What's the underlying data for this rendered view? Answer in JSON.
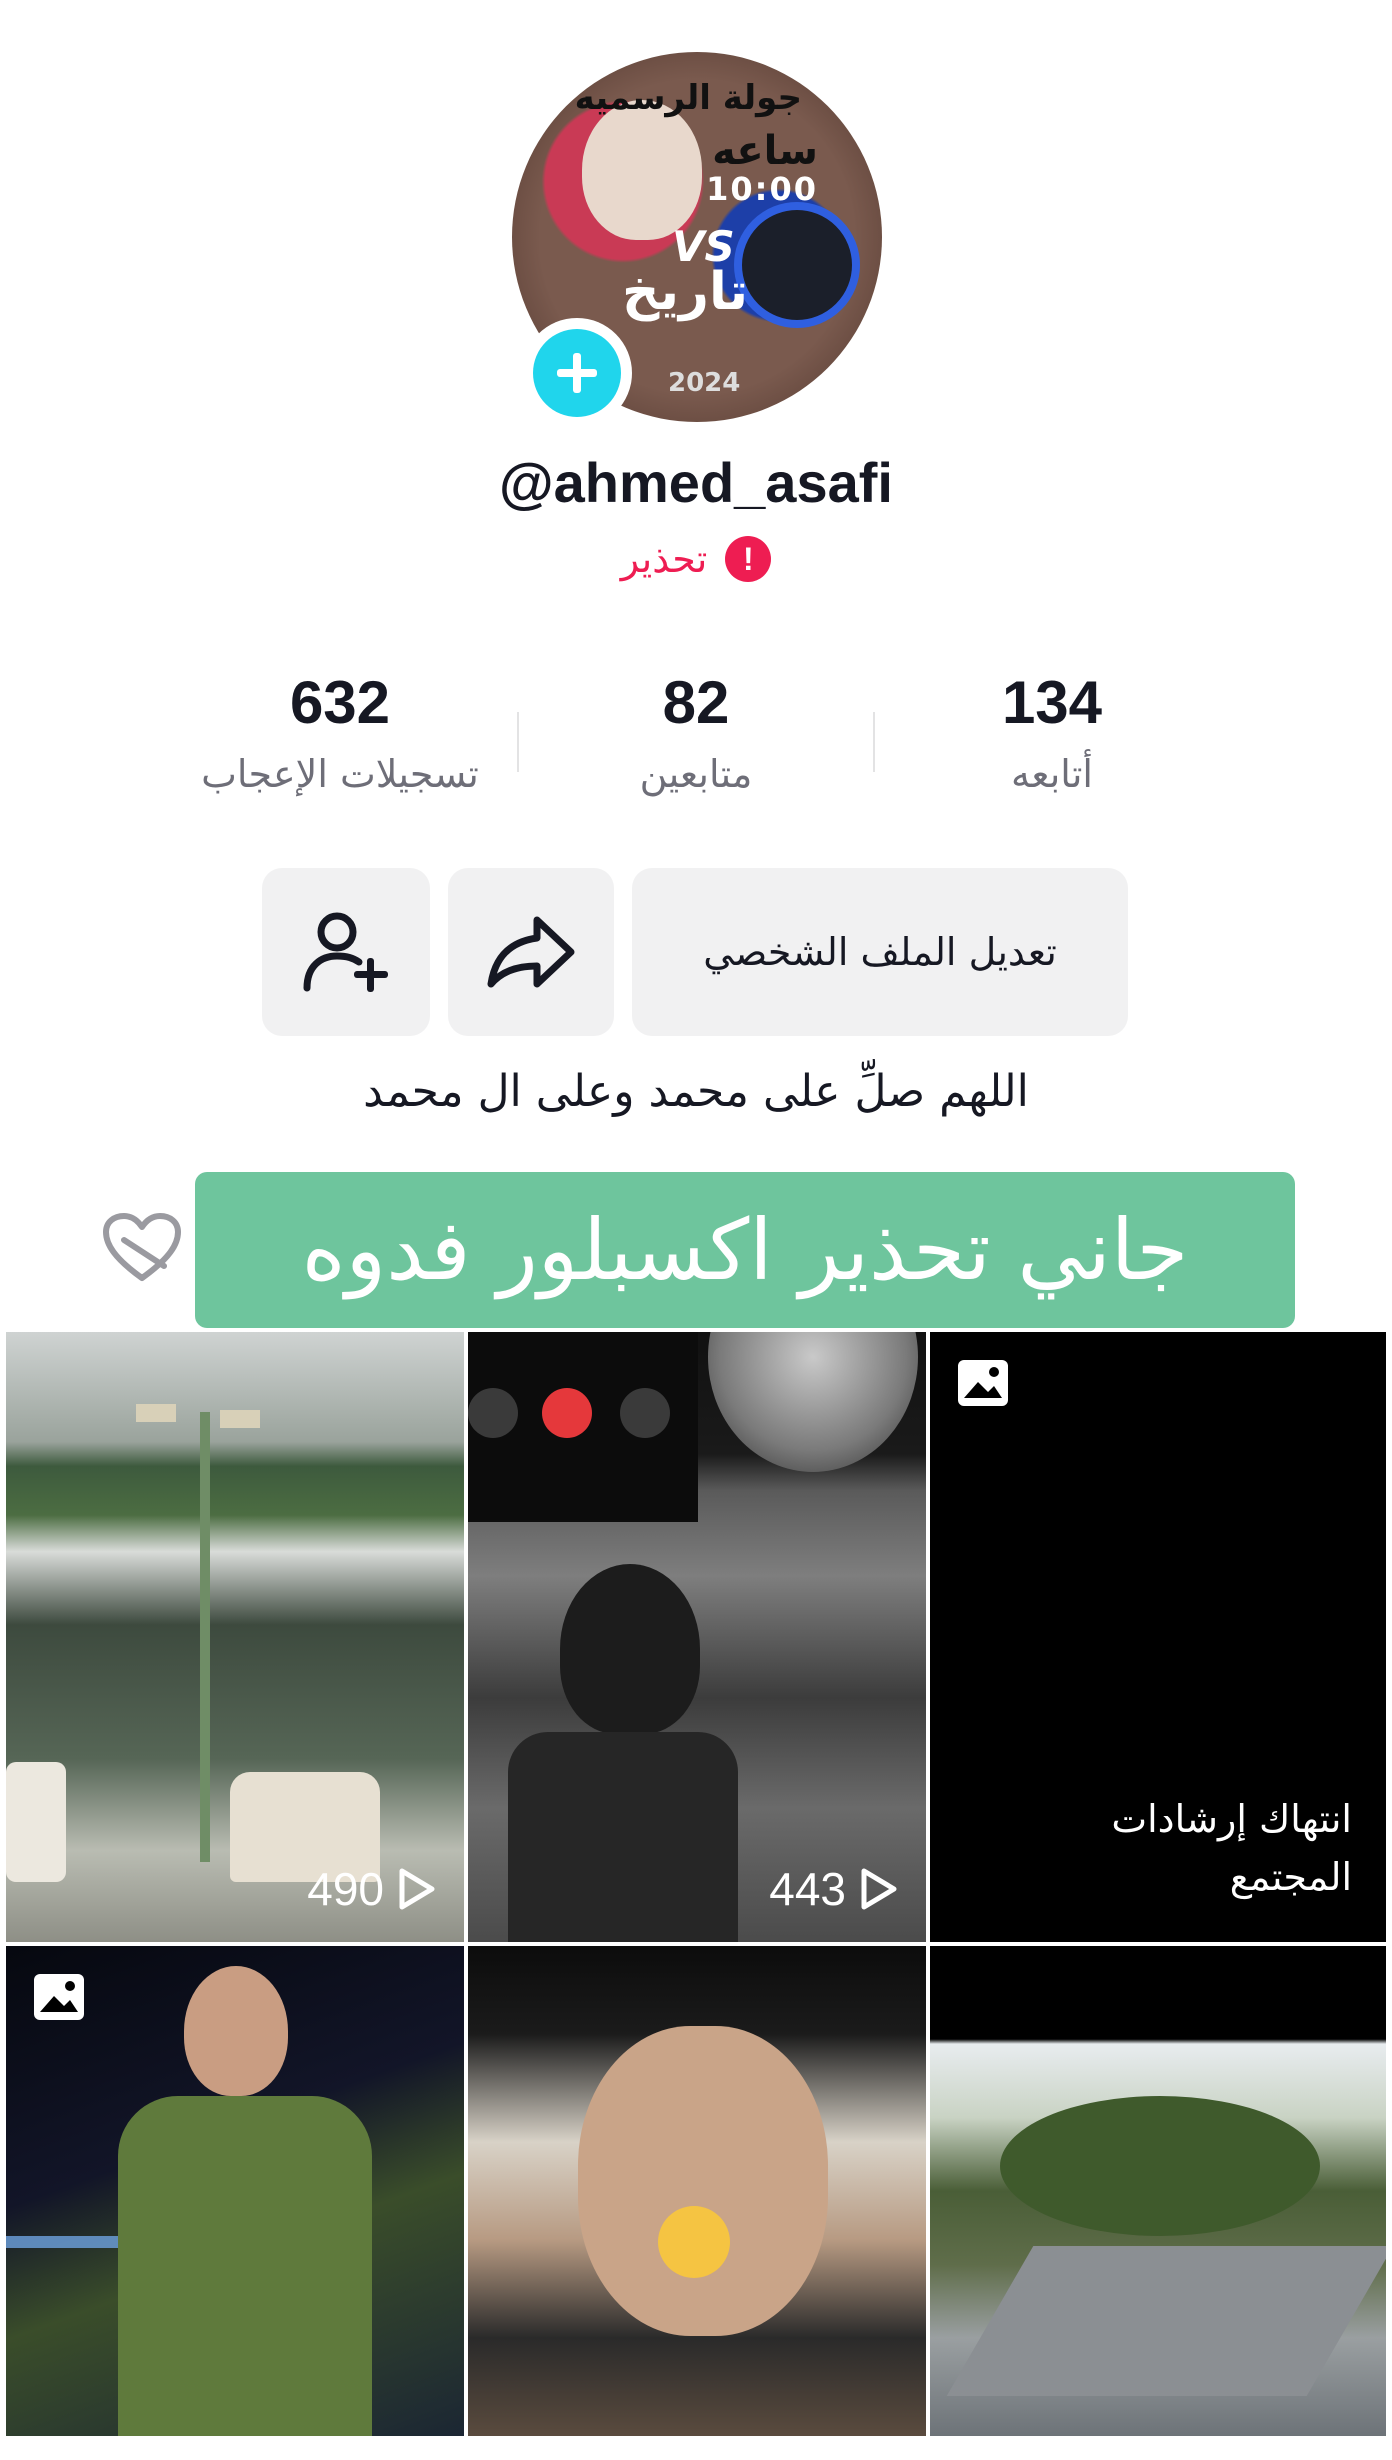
{
  "profile": {
    "username": "@ahmed_asafi",
    "warning_label": "تحذير",
    "warning_icon": "exclamation-icon",
    "bio": "اللهم صلِّ على محمد وعلى ال محمد"
  },
  "avatar_text": {
    "line1": "جولة الرسميه",
    "line2": "ساعه",
    "line3": "10:00",
    "line4": "VS",
    "line5": "تاريخ",
    "line6": "2024"
  },
  "stats": {
    "following": {
      "value": "134",
      "label": "أتابعه"
    },
    "followers": {
      "value": "82",
      "label": "متابعين"
    },
    "likes": {
      "value": "632",
      "label": "تسجيلات الإعجاب"
    }
  },
  "actions": {
    "edit_profile": "تعديل الملف الشخصي"
  },
  "banner": {
    "text": "جاني تحذير اكسبلور فدوه"
  },
  "grid": {
    "items": [
      {
        "views": "490",
        "type": "video"
      },
      {
        "views": "443",
        "type": "video"
      },
      {
        "caption": "انتهاك إرشادات المجتمع",
        "type": "photo"
      },
      {
        "type": "photo"
      },
      {
        "type": "video"
      },
      {
        "type": "video"
      }
    ]
  },
  "colors": {
    "accent_cyan": "#20d5ec",
    "warning_red": "#ee1d52",
    "banner_green": "#6ec59d",
    "button_bg": "#f1f1f2"
  }
}
